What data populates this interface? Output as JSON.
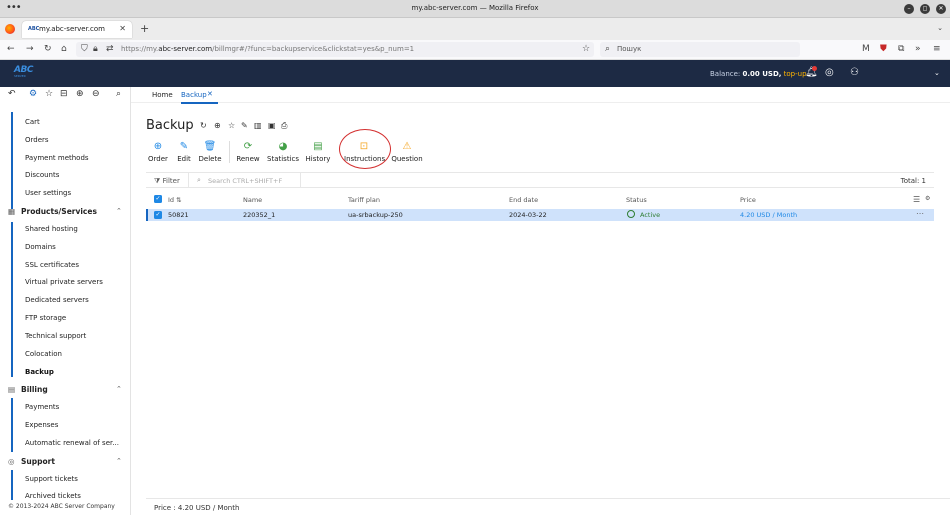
{
  "window": {
    "title": "my.abc-server.com — Mozilla Firefox"
  },
  "browser": {
    "tab_label": "my.abc-server.com",
    "tab_favicon_text": "ABC",
    "url_prefix": "https://my.",
    "url_domain": "abc-server.com",
    "url_suffix": "/billmgr#/?func=backupservice&clickstat=yes&p_num=1",
    "search_placeholder": "Пошук"
  },
  "header": {
    "logo_text": "ABC",
    "logo_sub": "SERVER",
    "balance_label": "Balance:",
    "balance_value": "0.00 USD,",
    "topup_label": "top-up"
  },
  "sidebar": {
    "items": [
      {
        "label": "Cart"
      },
      {
        "label": "Orders"
      },
      {
        "label": "Payment methods"
      },
      {
        "label": "Discounts"
      },
      {
        "label": "User settings"
      }
    ],
    "groups": [
      {
        "label": "Products/Services",
        "items": [
          {
            "label": "Shared hosting"
          },
          {
            "label": "Domains"
          },
          {
            "label": "SSL certificates"
          },
          {
            "label": "Virtual private servers"
          },
          {
            "label": "Dedicated servers"
          },
          {
            "label": "FTP storage"
          },
          {
            "label": "Technical support"
          },
          {
            "label": "Colocation"
          },
          {
            "label": "Backup"
          }
        ]
      },
      {
        "label": "Billing",
        "items": [
          {
            "label": "Payments"
          },
          {
            "label": "Expenses"
          },
          {
            "label": "Automatic renewal of ser..."
          }
        ]
      },
      {
        "label": "Support",
        "items": [
          {
            "label": "Support tickets"
          },
          {
            "label": "Archived tickets"
          }
        ]
      }
    ],
    "copyright": "© 2013-2024 ABC Server Company"
  },
  "breadcrumbs": [
    {
      "label": "Home"
    },
    {
      "label": "Backup"
    }
  ],
  "page": {
    "title": "Backup"
  },
  "toolbar": [
    {
      "label": "Order",
      "icon": "plus-circle-icon"
    },
    {
      "label": "Edit",
      "icon": "pencil-icon"
    },
    {
      "label": "Delete",
      "icon": "trash-icon"
    },
    {
      "label": "Renew",
      "icon": "renew-icon"
    },
    {
      "label": "Statistics",
      "icon": "pie-chart-icon"
    },
    {
      "label": "History",
      "icon": "history-icon"
    },
    {
      "label": "Instructions",
      "icon": "instructions-icon"
    },
    {
      "label": "Question",
      "icon": "question-icon"
    }
  ],
  "table": {
    "filter_label": "Filter",
    "search_placeholder": "Search CTRL+SHIFT+F",
    "total": "Total: 1",
    "columns": [
      "Id",
      "Name",
      "Tariff plan",
      "End date",
      "Status",
      "Price"
    ],
    "rows": [
      {
        "id": "50821",
        "name": "220352_1",
        "tariff": "ua-srbackup-250",
        "end_date": "2024-03-22",
        "status": "Active",
        "price": "4.20 USD / Month"
      }
    ]
  },
  "footer": {
    "text": "Price : 4.20 USD / Month"
  },
  "colors": {
    "accent": "#1565c0",
    "header_bg": "#1d2a44",
    "status_active": "#2e7d32",
    "topup": "#ffb400",
    "highlight": "#d32f2f"
  }
}
